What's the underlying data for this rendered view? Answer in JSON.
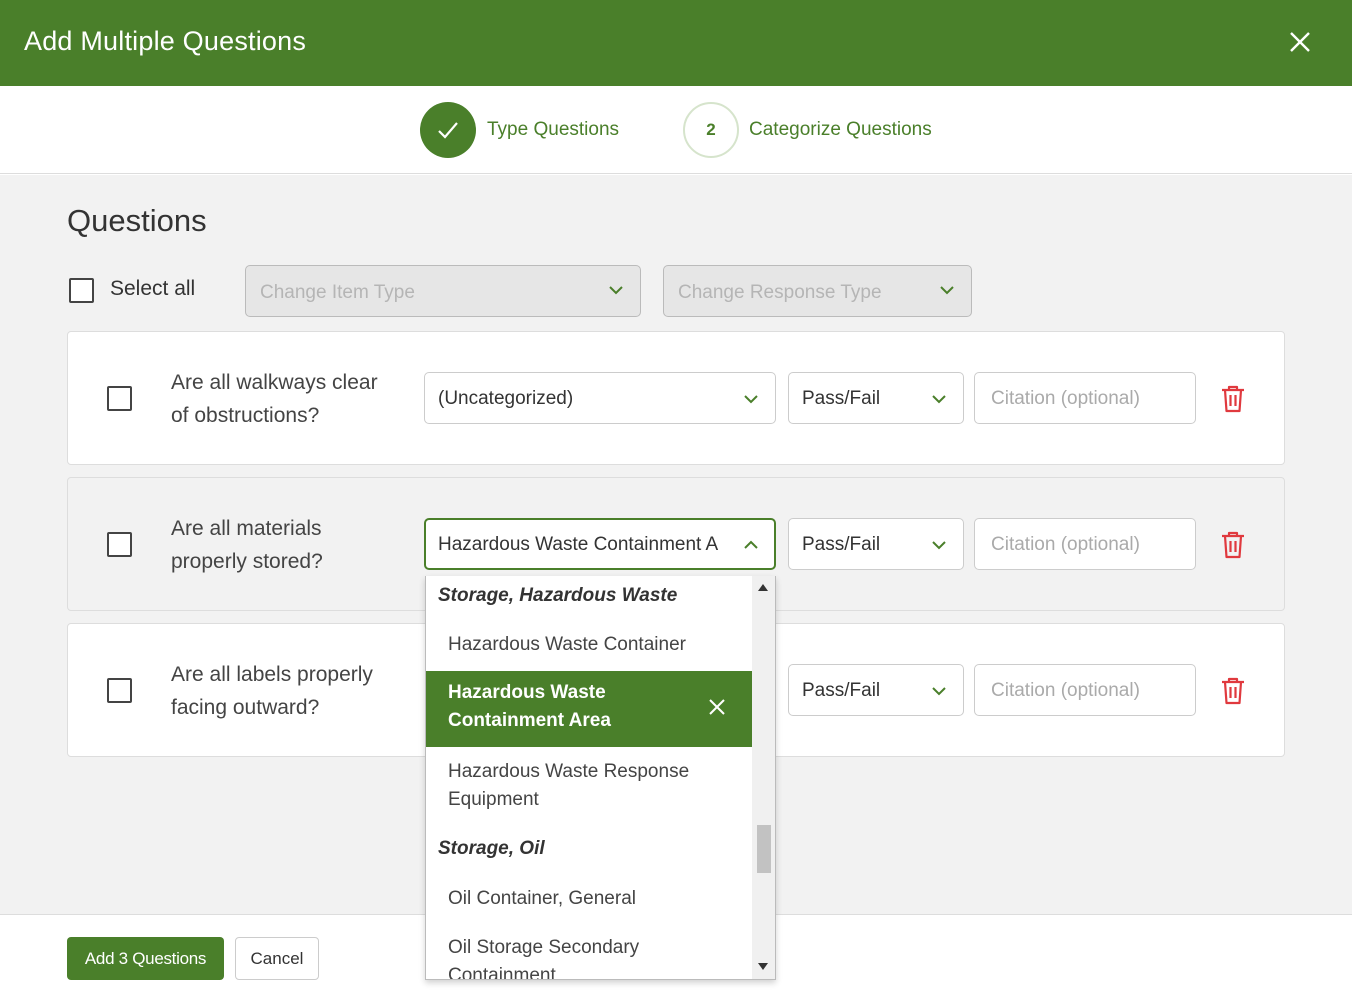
{
  "dialog": {
    "title": "Add Multiple Questions",
    "close_icon": "close-icon"
  },
  "stepper": {
    "steps": [
      {
        "label": "Type Questions",
        "state": "completed",
        "icon": "checkmark-icon"
      },
      {
        "label": "Categorize Questions",
        "state": "current",
        "number": "2"
      }
    ]
  },
  "main": {
    "title": "Questions",
    "select_all_label": "Select all",
    "select_all_checked": false,
    "bulk": {
      "item_type_placeholder": "Change Item Type",
      "response_type_placeholder": "Change Response Type"
    },
    "questions": [
      {
        "text": "Are all walkways clear of obstructions?",
        "category": "(Uncategorized)",
        "response": "Pass/Fail",
        "citation_placeholder": "Citation (optional)",
        "checked": false
      },
      {
        "text": "Are all materials properly stored?",
        "category": "Hazardous Waste Containment Area",
        "response": "Pass/Fail",
        "citation_placeholder": "Citation (optional)",
        "checked": false,
        "dropdown_open": true
      },
      {
        "text": "Are all labels properly facing outward?",
        "category": "",
        "response": "Pass/Fail",
        "citation_placeholder": "Citation (optional)",
        "checked": false
      }
    ]
  },
  "category_dropdown": {
    "groups": [
      {
        "label": "Storage, Hazardous Waste",
        "options": [
          "Hazardous Waste Container",
          "Hazardous Waste Containment Area",
          "Hazardous Waste Response Equipment"
        ]
      },
      {
        "label": "Storage, Oil",
        "options": [
          "Oil Container, General",
          "Oil Storage Secondary Containment"
        ]
      }
    ],
    "selected": "Hazardous Waste Containment Area"
  },
  "footer": {
    "primary_label": "Add 3 Questions",
    "cancel_label": "Cancel"
  },
  "colors": {
    "brand_green": "#4a7f2a",
    "delete_red": "#e0393e"
  }
}
